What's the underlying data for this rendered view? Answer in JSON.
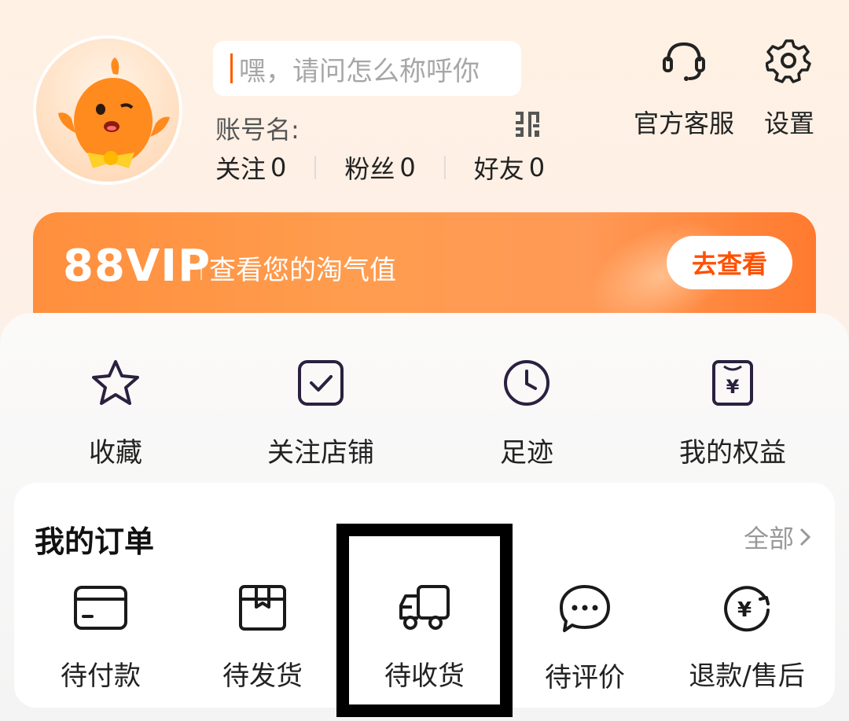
{
  "profile": {
    "nickname_placeholder": "嘿，请问怎么称呼你",
    "account_label": "账号名:",
    "stats": [
      {
        "label": "关注",
        "value": "0"
      },
      {
        "label": "粉丝",
        "value": "0"
      },
      {
        "label": "好友",
        "value": "0"
      }
    ]
  },
  "top_actions": {
    "service_label": "官方客服",
    "settings_label": "设置"
  },
  "vip": {
    "title": "88VIP",
    "description": "查看您的淘气值",
    "button_label": "去查看"
  },
  "quick_links": [
    {
      "label": "收藏",
      "icon": "star-icon"
    },
    {
      "label": "关注店铺",
      "icon": "check-square-icon"
    },
    {
      "label": "足迹",
      "icon": "clock-icon"
    },
    {
      "label": "我的权益",
      "icon": "voucher-icon"
    }
  ],
  "orders": {
    "title": "我的订单",
    "all_label": "全部",
    "items": [
      {
        "label": "待付款",
        "icon": "card-icon"
      },
      {
        "label": "待发货",
        "icon": "box-icon"
      },
      {
        "label": "待收货",
        "icon": "truck-icon"
      },
      {
        "label": "待评价",
        "icon": "chat-icon"
      },
      {
        "label": "退款/售后",
        "icon": "refund-icon"
      }
    ]
  },
  "colors": {
    "accent": "#ff5000",
    "vip_gradient_start": "#ff8f3d",
    "highlight_border": "#000000"
  }
}
